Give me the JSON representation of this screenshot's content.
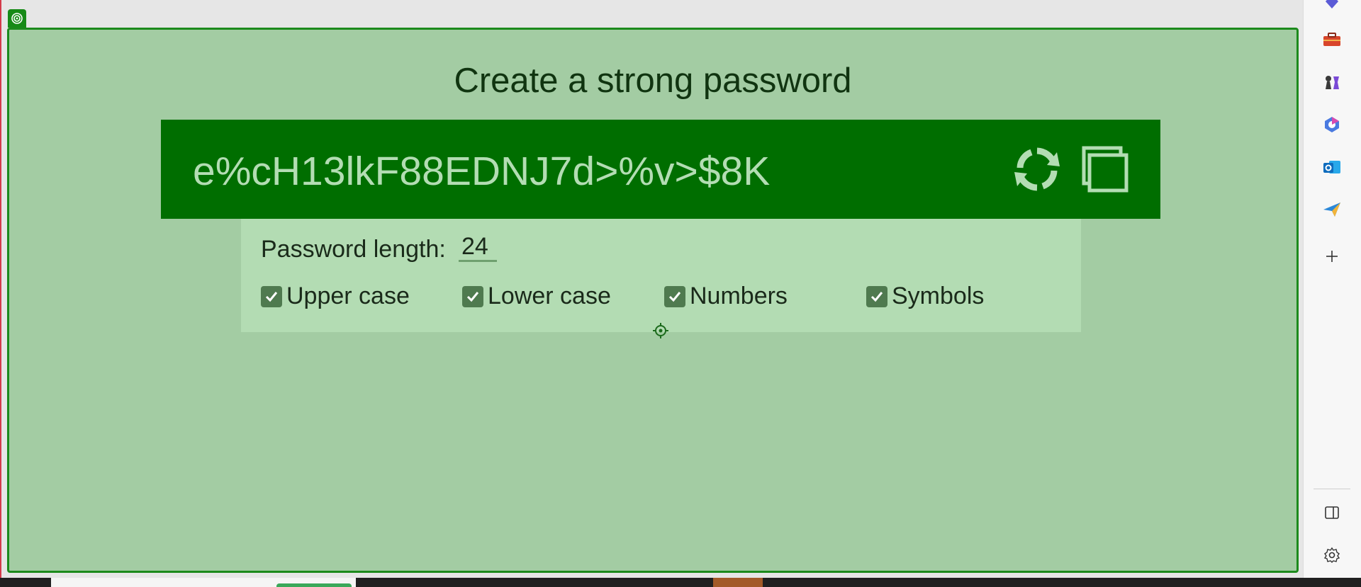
{
  "app": {
    "title": "Create a strong password"
  },
  "password": {
    "value": "e%cH13lkF88EDNJ7d>%v>$8K",
    "refresh_icon": "refresh-icon",
    "copy_icon": "copy-icon"
  },
  "options": {
    "length_label": "Password length:",
    "length_value": "24",
    "checkboxes": [
      {
        "label": "Upper case",
        "checked": true
      },
      {
        "label": "Lower case",
        "checked": true
      },
      {
        "label": "Numbers",
        "checked": true
      },
      {
        "label": "Symbols",
        "checked": true
      }
    ]
  },
  "sidebar": {
    "items": [
      {
        "name": "shield-icon",
        "color": "#5b5bd6"
      },
      {
        "name": "toolbox-icon",
        "color": "#d8452b"
      },
      {
        "name": "chess-icon",
        "color": "#7a4ad6"
      },
      {
        "name": "copilot-icon",
        "color": "#4a7ae0"
      },
      {
        "name": "outlook-icon",
        "color": "#0f6cbd"
      },
      {
        "name": "send-icon",
        "color": "#2b88d8"
      },
      {
        "name": "add-icon",
        "color": "#333333"
      },
      {
        "name": "sidebar-toggle-icon",
        "color": "#333333"
      },
      {
        "name": "settings-icon",
        "color": "#333333"
      }
    ]
  },
  "colors": {
    "panel": "#a3cca3",
    "password_bar": "#006e00",
    "password_text": "#b3ddb3",
    "options_bg": "#b3dcb3",
    "checkbox": "#4f7a4f"
  }
}
